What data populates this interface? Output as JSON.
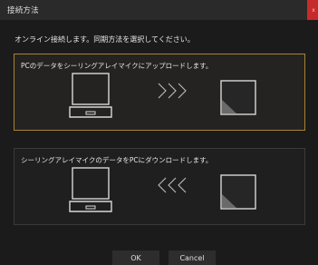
{
  "window": {
    "title": "接続方法",
    "close_glyph": "x"
  },
  "instruction": "オンライン接続します。同期方法を選択してください。",
  "options": [
    {
      "label": "PCのデータをシーリングアレイマイクにアップロードします。",
      "selected": true,
      "from_icon": "laptop-icon",
      "arrow_icon": "chevrons-right-icon",
      "to_icon": "ceiling-array-mic-icon"
    },
    {
      "label": "シーリングアレイマイクのデータをPCにダウンロードします。",
      "selected": false,
      "from_icon": "laptop-icon",
      "arrow_icon": "chevrons-left-icon",
      "to_icon": "ceiling-array-mic-icon"
    }
  ],
  "buttons": {
    "ok": "OK",
    "cancel": "Cancel"
  },
  "colors": {
    "background": "#1b1b1b",
    "selected_border": "#a88332",
    "close_button": "#c72a2a"
  }
}
